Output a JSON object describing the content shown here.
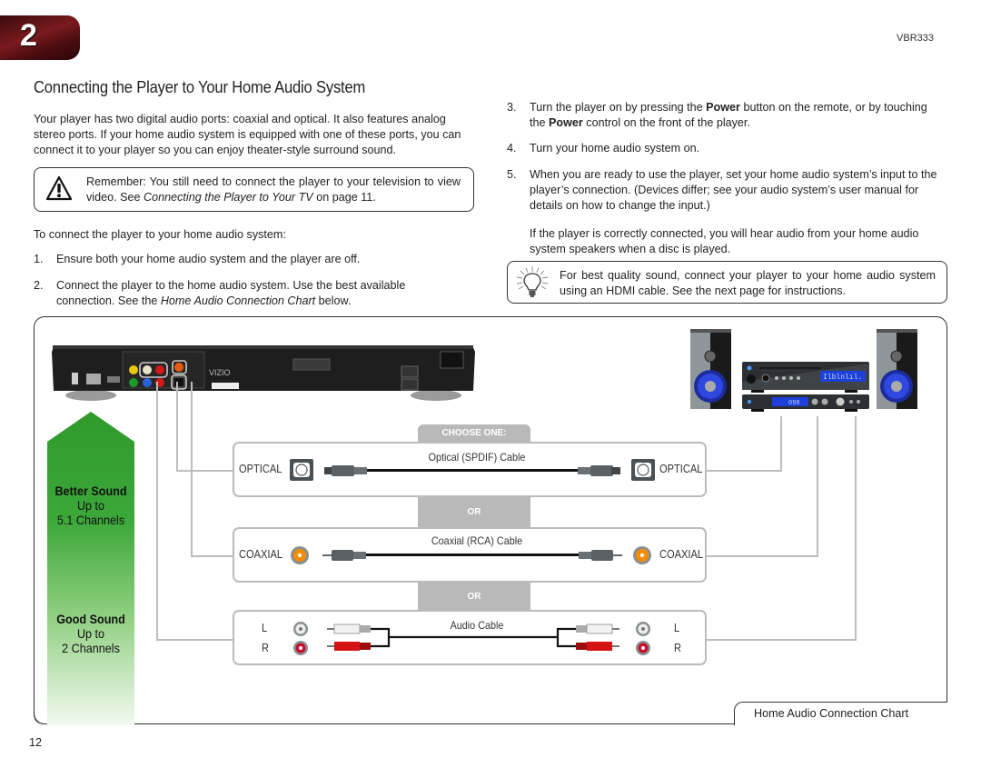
{
  "header": {
    "chapter_number": "2",
    "model": "VBR333"
  },
  "section_title": "Connecting the Player to Your Home Audio System",
  "intro": "Your player has two digital audio ports: coaxial and optical. It also features analog stereo ports. If your home audio system is equipped with one of these ports, you can connect it to your player so you can enjoy theater-style surround sound.",
  "warning_note": {
    "icon": "warning-triangle-icon",
    "text_before": "Remember: You still need to connect the player to your television to view video. See ",
    "link_text": "Connecting the Player to Your TV",
    "text_after": " on page 11."
  },
  "lead_in": "To connect the player to your home audio system:",
  "steps": [
    {
      "number": "1.",
      "text": "Ensure both your home audio system and the player are off."
    },
    {
      "number": "2.",
      "text_before": "Connect the player to the home audio system. Use the best available connection. See the ",
      "ref": "Home Audio Connection Chart",
      "text_after": " below."
    },
    {
      "number": "3.",
      "text_a": "Turn the player on by pressing the ",
      "bold_a": "Power",
      "text_b": " button on the remote, or by touching the ",
      "bold_b": "Power",
      "text_c": " control on the front of the player."
    },
    {
      "number": "4.",
      "text": "Turn your home audio system on."
    },
    {
      "number": "5.",
      "text": "When you are ready to use the player, set your home audio system’s input to the player’s connection. (Devices differ; see your audio system’s user manual for details on how to change the input.)",
      "followup": "If the player is correctly connected, you will hear audio from your home audio system speakers when a disc is played."
    }
  ],
  "tip_note": {
    "icon": "lightbulb-icon",
    "text": "For best quality sound, connect your player to your home audio system using an HDMI cable. See the next page for instructions."
  },
  "diagram": {
    "caption": "Home Audio Connection Chart",
    "choose_label": "CHOOSE ONE:",
    "or_label": "OR",
    "quality": [
      {
        "title": "Better Sound",
        "line1": "Up to",
        "line2": "5.1 Channels"
      },
      {
        "title": "Good Sound",
        "line1": "Up to",
        "line2": "2 Channels"
      }
    ],
    "connections": [
      {
        "left_label": "OPTICAL",
        "cable": "Optical (SPDIF) Cable",
        "right_label": "OPTICAL"
      },
      {
        "left_label": "COAXIAL",
        "cable": "Coaxial (RCA) Cable",
        "right_label": "COAXIAL"
      },
      {
        "left_l": "L",
        "left_r": "R",
        "cable": "Audio Cable",
        "right_l": "L",
        "right_r": "R"
      }
    ],
    "player_brand": "VIZIO",
    "stereo_display_top": "Ilblnlıl.",
    "stereo_display_bottom": "098"
  },
  "footer": {
    "page_number": "12"
  },
  "colors": {
    "chapter_tab": "#6b1418",
    "green_arrow": "#2e9a2a",
    "connector_gray": "#bdbdbd",
    "coax_orange": "#f28c00",
    "rca_red": "#c8102e",
    "stereo_blue": "#2a4fd8"
  }
}
